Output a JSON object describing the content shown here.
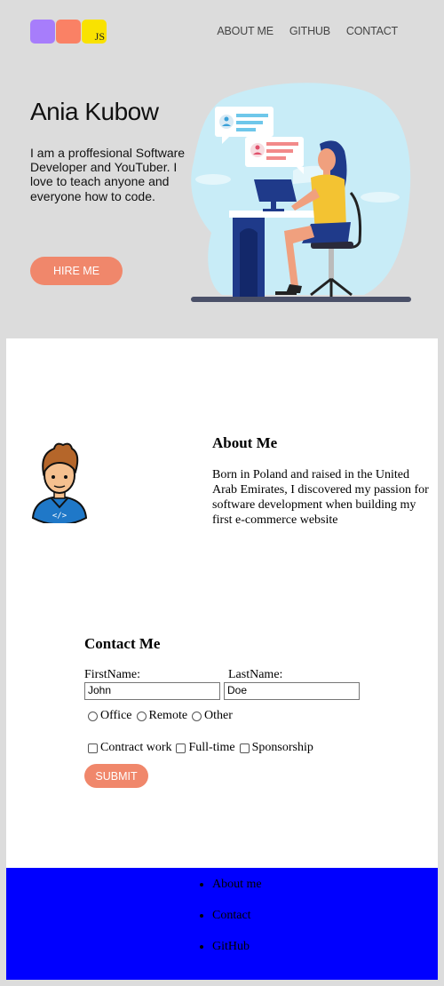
{
  "header": {
    "logo": {
      "colors": [
        "#a77dfb",
        "#fa8165",
        "#f9e201"
      ],
      "js_label": "JS"
    },
    "nav": [
      "ABOUT ME",
      "GITHUB",
      "CONTACT"
    ]
  },
  "hero": {
    "name": "Ania Kubow",
    "description": "I am a proffesional Software Developer and YouTuber. I love to teach anyone and everyone how to code.",
    "hire_label": "HIRE ME",
    "illustration": "developer-at-desk-illustration"
  },
  "about": {
    "title": "About Me",
    "text": "Born in Poland and raised in the United Arab Emirates, I discovered my passion for software development when building my first e-commerce website",
    "avatar": "developer-avatar"
  },
  "contact": {
    "title": "Contact Me",
    "first_label": "FirstName:",
    "last_label": "LastName:",
    "first_value": "John",
    "last_value": "Doe",
    "radios": [
      "Office",
      "Remote",
      "Other"
    ],
    "checkboxes": [
      "Contract work",
      "Full-time",
      "Sponsorship"
    ],
    "submit_label": "SUBMIT"
  },
  "footer": {
    "links": [
      "About me",
      "Contact",
      "GitHub"
    ],
    "background": "#0000ff"
  },
  "colors": {
    "accent": "#f0876b",
    "page_bg": "#dcdcdc"
  }
}
